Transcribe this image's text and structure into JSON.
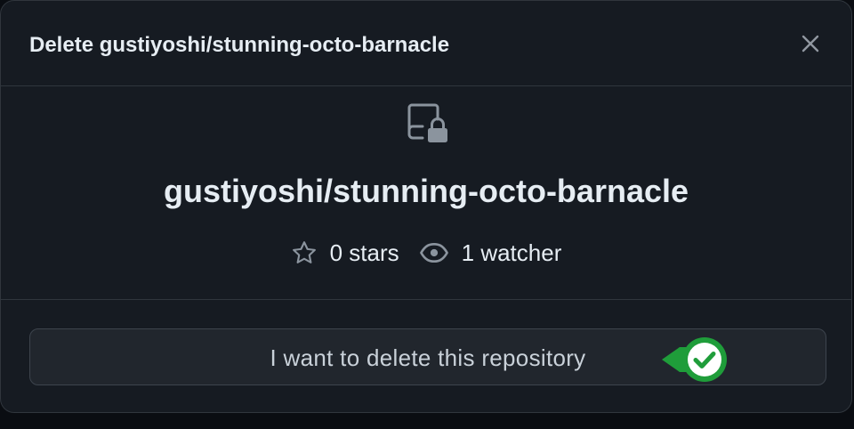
{
  "dialog": {
    "title": "Delete gustiyoshi/stunning-octo-barnacle",
    "close_icon": "x-icon"
  },
  "repo": {
    "icon": "repo-locked-icon",
    "full_name": "gustiyoshi/stunning-octo-barnacle",
    "stars_label": "0 stars",
    "watchers_label": "1 watcher",
    "star_icon": "star-icon",
    "watcher_icon": "eye-icon"
  },
  "confirm": {
    "label": "I want to delete this repository",
    "badge_icon": "check-circle-icon"
  },
  "colors": {
    "background": "#161b22",
    "border": "#30363d",
    "text": "#e6edf3",
    "muted": "#8b949e",
    "button_bg": "#21262d",
    "badge_green": "#1f9d3a"
  }
}
